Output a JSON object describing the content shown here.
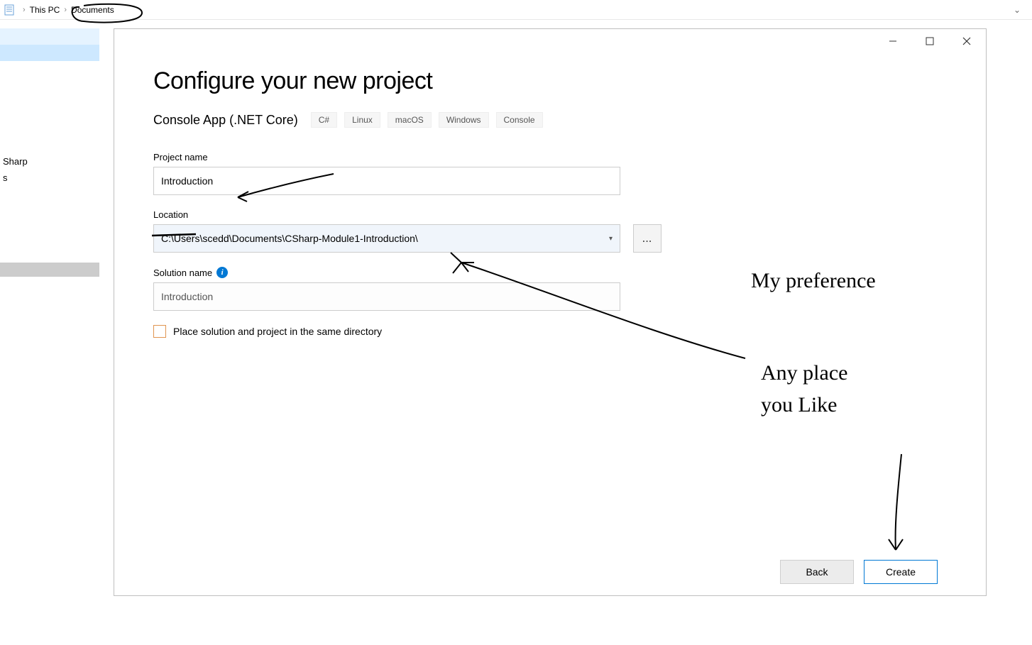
{
  "breadcrumb": {
    "item1": "This PC",
    "item2": "Documents"
  },
  "sidebar": {
    "item_sharp": "Sharp",
    "item_s": "s"
  },
  "dialog": {
    "title": "Configure your new project",
    "subtitle": "Console App (.NET Core)",
    "tags": [
      "C#",
      "Linux",
      "macOS",
      "Windows",
      "Console"
    ],
    "project_name_label": "Project name",
    "project_name_value": "Introduction",
    "location_label": "Location",
    "location_value": "C:\\Users\\scedd\\Documents\\CSharp-Module1-Introduction\\",
    "browse_label": "...",
    "solution_name_label": "Solution name",
    "solution_name_value": "Introduction",
    "checkbox_label": "Place solution and project in the same directory",
    "back_label": "Back",
    "create_label": "Create"
  },
  "annotations": {
    "note1": "My preference",
    "note2_line1": "Any place",
    "note2_line2": "you Like"
  }
}
